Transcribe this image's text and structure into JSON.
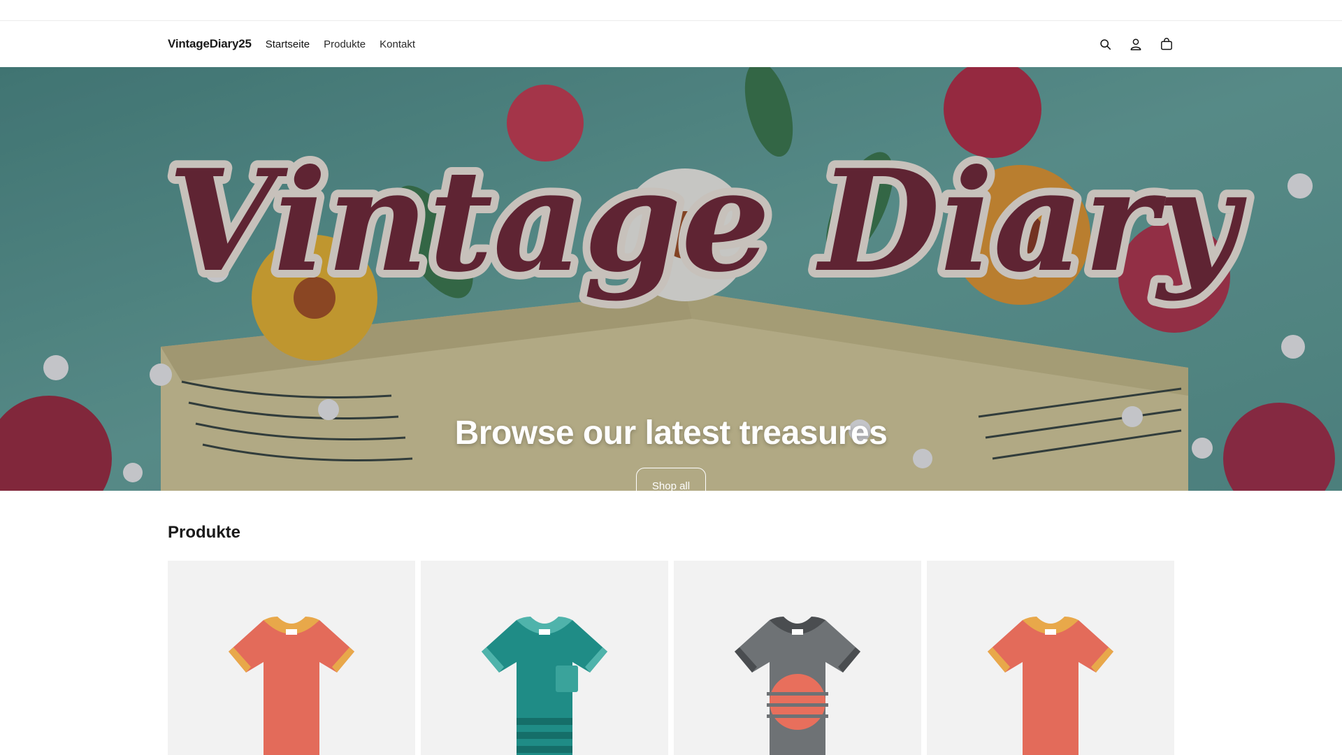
{
  "header": {
    "logo": "VintageDiary25",
    "nav": [
      {
        "label": "Startseite",
        "active": true
      },
      {
        "label": "Produkte",
        "active": false
      },
      {
        "label": "Kontakt",
        "active": false
      }
    ],
    "icons": [
      "search-icon",
      "account-icon",
      "cart-icon"
    ]
  },
  "hero": {
    "image_text": "Vintage Diary",
    "title": "Browse our latest treasures",
    "button_label": "Shop all"
  },
  "products": {
    "title": "Produkte",
    "items": [
      {
        "color": "#e36b5a",
        "trim": "#e8a84a",
        "style": "plain"
      },
      {
        "color": "#1f8c86",
        "trim": "#4fb3ab",
        "style": "pocket-stripes"
      },
      {
        "color": "#6e7275",
        "trim": "#4a4d50",
        "style": "sunset"
      },
      {
        "color": "#e36b5a",
        "trim": "#e8a84a",
        "style": "plain"
      }
    ]
  }
}
